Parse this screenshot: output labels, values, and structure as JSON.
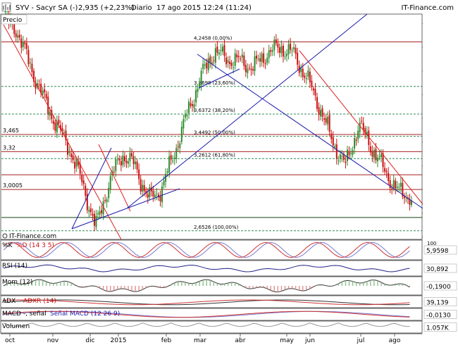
{
  "header": {
    "symbol": "SYV - Sacyr SA (-)",
    "price_change": "2,935 (+2,23%)",
    "period": "Diario",
    "datetime": "17 ago 2015 12:24 (11:24)",
    "brand": "IT-Finance.com"
  },
  "main_panel": {
    "label": "Precio",
    "watermark": "IT-Finance.com",
    "current_price_label": "2,935",
    "y_ticks": [
      "4,4",
      "4,2",
      "4",
      "3,8",
      "3,6",
      "3,4",
      "3,2",
      "3",
      "2,8",
      "2,6"
    ],
    "y_range": [
      2.58,
      4.48
    ],
    "horizontal_levels": [
      {
        "label": "3,465",
        "value": 3.465
      },
      {
        "label": "3,32",
        "value": 3.32
      },
      {
        "label": "3,0005",
        "value": 3.0005
      }
    ],
    "fibonacci": [
      {
        "label": "4,2458 (0,00%)",
        "value": 4.2458
      },
      {
        "label": "3,8698 (23,60%)",
        "value": 3.8698
      },
      {
        "label": "3,6372 (38,20%)",
        "value": 3.6372
      },
      {
        "label": "3,4492 (50,00%)",
        "value": 3.4492
      },
      {
        "label": "3,2612 (61,80%)",
        "value": 3.2612
      },
      {
        "label": "2,6526 (100,00%)",
        "value": 2.6526
      }
    ]
  },
  "x_axis": {
    "labels": [
      "oct",
      "nov",
      "dic",
      "2015",
      "feb",
      "mar",
      "abr",
      "may",
      "jun",
      "jul",
      "ago"
    ]
  },
  "indicators": [
    {
      "key": "stoch",
      "label1": "%K",
      "label2": "%D (14 3 5)",
      "value": "5,9598",
      "tick": "100"
    },
    {
      "key": "rsi",
      "label1": "RSI (14)",
      "label2": "",
      "value": "30,892",
      "tick": ""
    },
    {
      "key": "mom",
      "label1": "Mom (12)",
      "label2": "",
      "value": "-0,1900",
      "tick": ""
    },
    {
      "key": "adx",
      "label1": "ADX",
      "label2": "ADXR (14)",
      "value": "39,139",
      "tick": ""
    },
    {
      "key": "macd",
      "label1": "MACD -, señal",
      "label2": "Señal",
      "label3": "MACD (12 26 9)",
      "value": "-0,0130",
      "tick": ""
    },
    {
      "key": "vol",
      "label1": "Volumen",
      "label2": "",
      "value": "1.057K",
      "tick": ""
    }
  ],
  "colors": {
    "up": "#2e8b2e",
    "down": "#cc1111",
    "trend_red": "#dd2222",
    "trend_blue": "#1a1aaa",
    "fib_dash": "#2e8b57",
    "label_box": "#c8e6c8"
  },
  "chart_data": {
    "type": "line",
    "title": "SYV - Sacyr SA (-)",
    "xlabel": "",
    "ylabel": "",
    "ylim": [
      2.58,
      4.48
    ],
    "x": [
      "oct",
      "nov",
      "dic",
      "2015",
      "feb",
      "mar",
      "abr",
      "may",
      "jun",
      "jul",
      "ago"
    ],
    "series": [
      {
        "name": "Precio",
        "values": [
          4.43,
          4.35,
          4.05,
          3.78,
          3.55,
          3.35,
          3.05,
          2.68,
          3.05,
          3.3,
          3.2,
          2.92,
          3.0,
          3.32,
          3.65,
          3.95,
          4.17,
          4.1,
          4.08,
          4.03,
          4.15,
          4.2,
          4.15,
          3.95,
          3.7,
          3.4,
          3.2,
          3.55,
          3.35,
          3.15,
          2.98,
          2.935
        ]
      }
    ]
  }
}
